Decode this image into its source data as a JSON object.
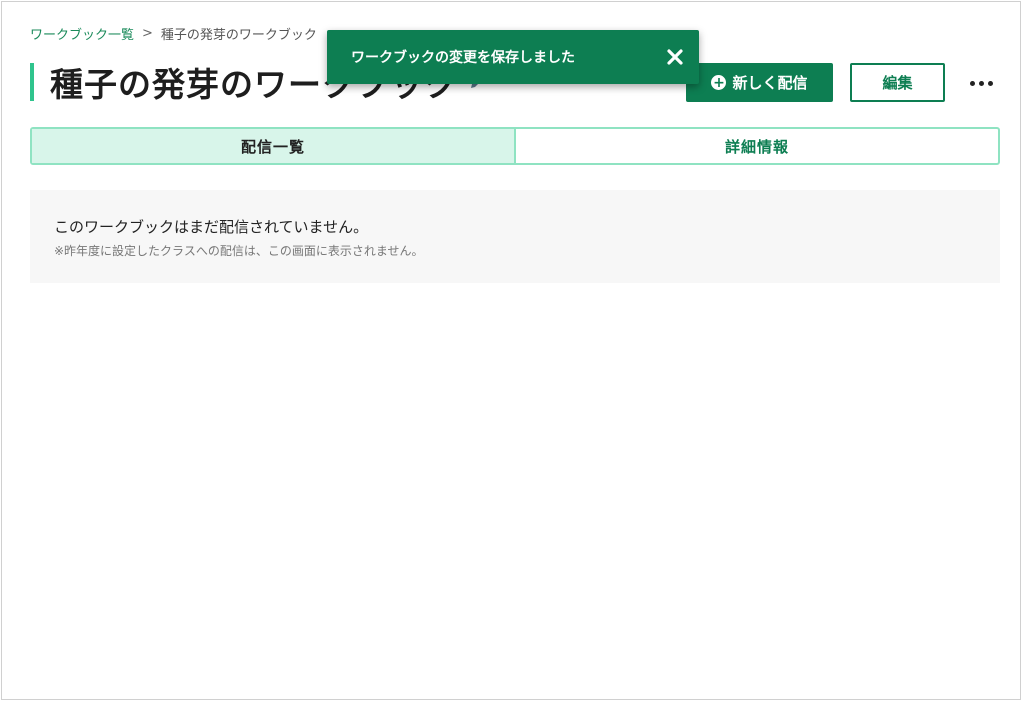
{
  "breadcrumb": {
    "parent_label": "ワークブック一覧",
    "separator": ">",
    "current_label": "種子の発芽のワークブック"
  },
  "header": {
    "title": "種子の発芽のワークブック",
    "new_distribution_label": "新しく配信",
    "edit_label": "編集",
    "more_icon": "more-horizontal-icon"
  },
  "tabs": [
    {
      "label": "配信一覧",
      "active": true
    },
    {
      "label": "詳細情報",
      "active": false
    }
  ],
  "empty_state": {
    "message": "このワークブックはまだ配信されていません。",
    "note": "※昨年度に設定したクラスへの配信は、この画面に表示されません。"
  },
  "toast": {
    "message": "ワークブックの変更を保存しました",
    "close_icon": "close-icon"
  },
  "colors": {
    "brand": "#0d7e52",
    "accent_bar": "#2fc48d",
    "tab_border": "#8fe3c2",
    "tab_active_bg": "#d8f5ea"
  }
}
